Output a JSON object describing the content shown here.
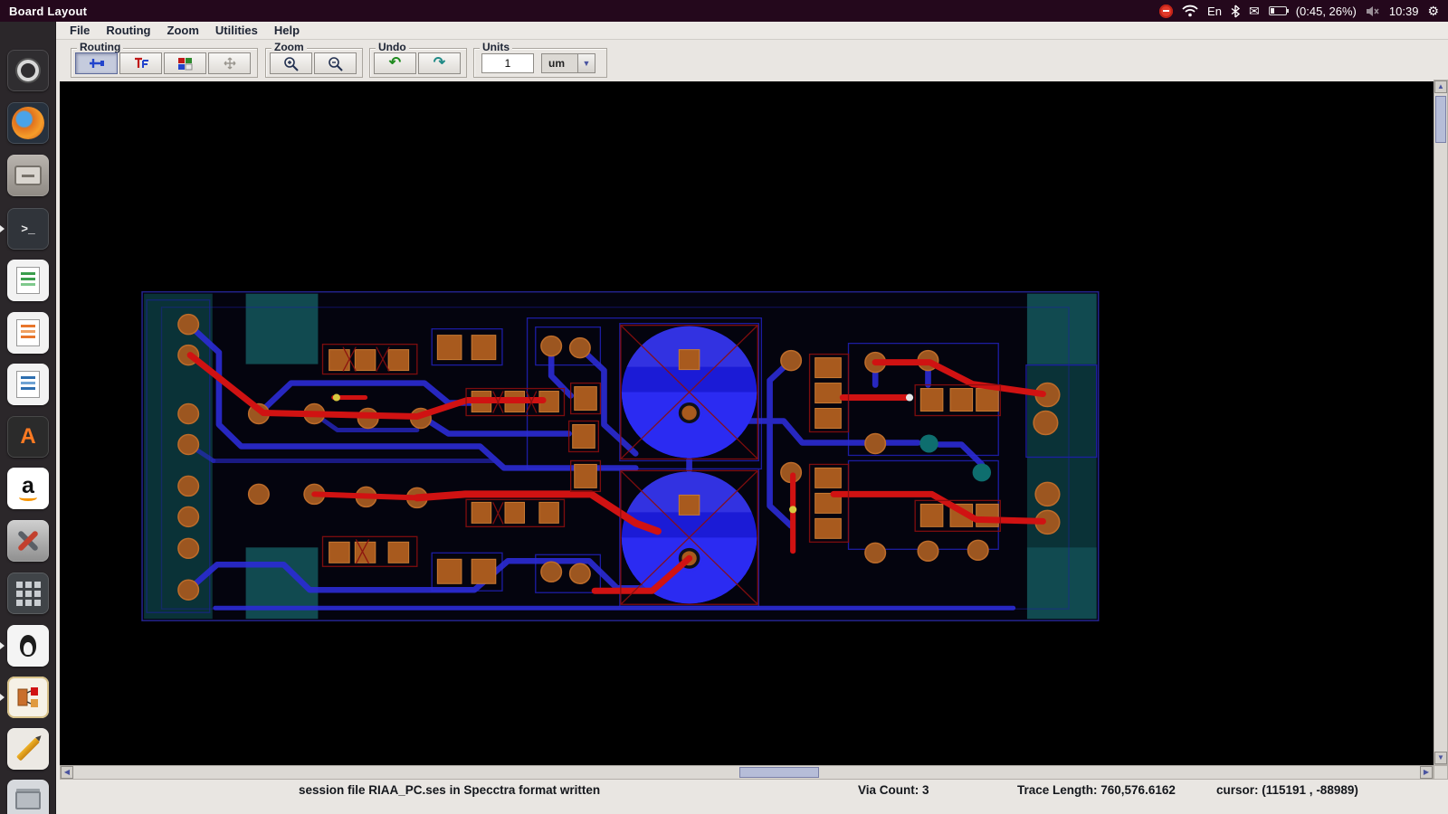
{
  "topbar": {
    "title": "Board Layout",
    "keyboard": "En",
    "battery": "(0:45, 26%)",
    "time": "10:39"
  },
  "glyphs": {
    "gear": "⚙",
    "mail": "✉",
    "undo": "↶",
    "redo": "↷",
    "up": "▲",
    "down": "▼",
    "left": "◀",
    "right": "▶",
    "combo_arrow": "▼",
    "terminal_prompt": ">_"
  },
  "launcher": {
    "items": [
      "dash-home",
      "firefox",
      "file-archiver",
      "terminal",
      "libreoffice-calc",
      "libreoffice-impress",
      "libreoffice-writer",
      "text-editor-a",
      "amazon",
      "system-settings",
      "calculator",
      "bird-app",
      "board-layout",
      "pencil-editor",
      "files-stack"
    ]
  },
  "menubar": {
    "items": [
      "File",
      "Routing",
      "Zoom",
      "Utilities",
      "Help"
    ]
  },
  "toolbar": {
    "routing": {
      "label": "Routing"
    },
    "zoom": {
      "label": "Zoom"
    },
    "undo": {
      "label": "Undo"
    },
    "units": {
      "label": "Units",
      "value": "1",
      "unit": "um"
    }
  },
  "statusbar": {
    "message": "session file RIAA_PC.ses in Specctra format written",
    "via_count": "Via Count: 3",
    "trace_length": "Trace Length: 760,576.6162",
    "cursor": "cursor: (115191 , -88989)"
  },
  "colors": {
    "trace_top": "#d01212",
    "trace_bottom": "#2b2bd4",
    "pad_copper": "#a85a1e",
    "pour_teal": "#0a3237",
    "cap_blue": "#2b2bf2"
  }
}
